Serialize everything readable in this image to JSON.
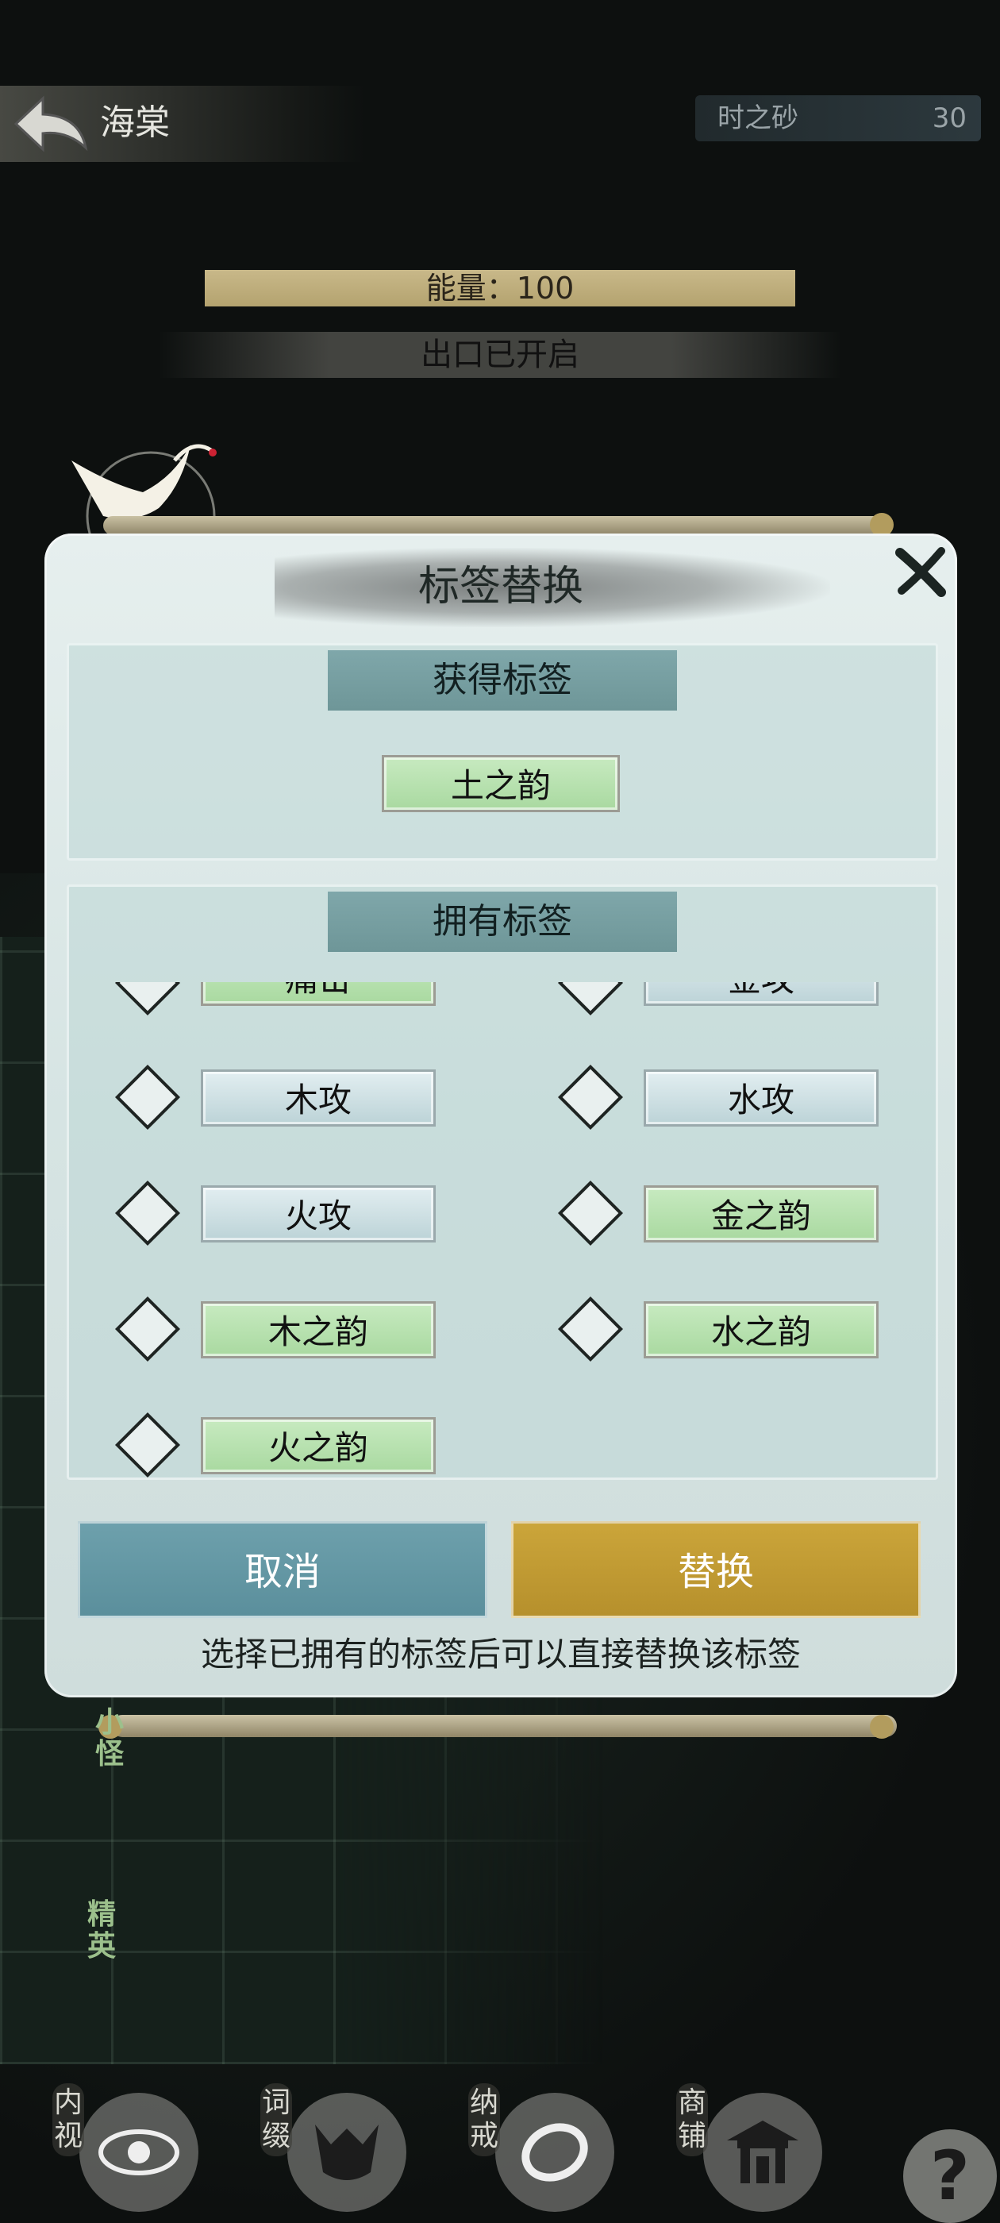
{
  "header": {
    "title": "海棠",
    "currency_label": "时之砂",
    "currency_value": "30"
  },
  "status": {
    "energy": "能量：100",
    "exit": "出口已开启"
  },
  "dialog": {
    "title": "标签替换",
    "gain_section": {
      "header": "获得标签",
      "tag": "土之韵"
    },
    "own_section": {
      "header": "拥有标签",
      "tags": [
        {
          "label": "痛击",
          "style": "green",
          "selected": false
        },
        {
          "label": "金攻",
          "style": "blue",
          "selected": false
        },
        {
          "label": "木攻",
          "style": "blue",
          "selected": false
        },
        {
          "label": "水攻",
          "style": "blue",
          "selected": false
        },
        {
          "label": "火攻",
          "style": "blue",
          "selected": false
        },
        {
          "label": "金之韵",
          "style": "green",
          "selected": false
        },
        {
          "label": "木之韵",
          "style": "green",
          "selected": false
        },
        {
          "label": "水之韵",
          "style": "green",
          "selected": false
        },
        {
          "label": "火之韵",
          "style": "green",
          "selected": false
        }
      ]
    },
    "cancel_label": "取消",
    "replace_label": "替换",
    "hint": "选择已拥有的标签后可以直接替换该标签"
  },
  "side_markers": {
    "minion": "小怪",
    "elite": "精英"
  },
  "bottom_nav": [
    {
      "label": "内视",
      "icon": "eye-icon"
    },
    {
      "label": "词缀",
      "icon": "demon-mask-icon"
    },
    {
      "label": "纳戒",
      "icon": "ring-icon"
    },
    {
      "label": "商铺",
      "icon": "pavilion-icon"
    }
  ],
  "help_label": "?",
  "colors": {
    "cancel": "#5b8f9c",
    "replace": "#b6902c",
    "tag_green": "#a9d9a0",
    "tag_blue": "#bcd3d7"
  }
}
